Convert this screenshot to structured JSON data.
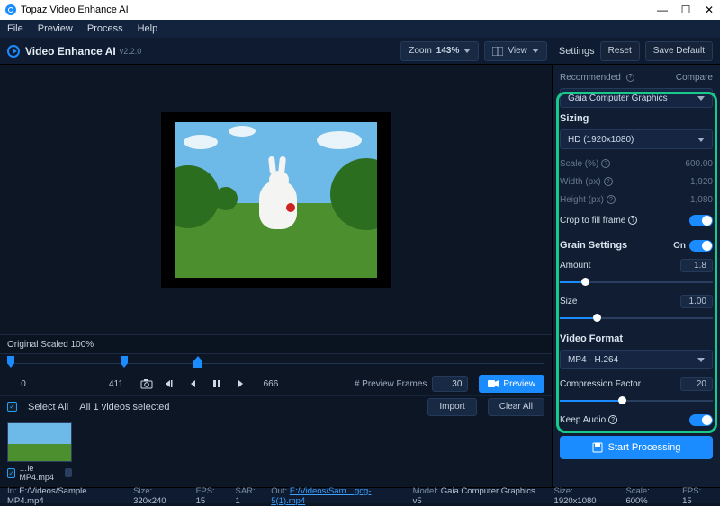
{
  "window": {
    "title": "Topaz Video Enhance AI",
    "controls": {
      "min": "—",
      "max": "☐",
      "close": "✕"
    }
  },
  "menus": [
    "File",
    "Preview",
    "Process",
    "Help"
  ],
  "header": {
    "app_name": "Video Enhance AI",
    "version": "v2.2.0",
    "zoom_label": "Zoom",
    "zoom_value": "143%",
    "view_label": "View",
    "settings_label": "Settings",
    "reset_label": "Reset",
    "save_default_label": "Save Default"
  },
  "preview": {
    "scale_label": "Original Scaled 100%"
  },
  "timeline": {
    "start": "0",
    "current": "411",
    "end": "666",
    "preview_frames_label": "# Preview Frames",
    "preview_frames_value": "30",
    "preview_button": "Preview"
  },
  "list": {
    "select_all": "Select All",
    "selected_text": "All 1 videos selected",
    "import_btn": "Import",
    "clear_btn": "Clear All",
    "thumb_name": "…le MP4.mp4"
  },
  "panel": {
    "recommended": "Recommended",
    "compare": "Compare",
    "model_dd": "Gaia Computer Graphics",
    "sizing_title": "Sizing",
    "size_preset": "HD (1920x1080)",
    "scale_label": "Scale (%)",
    "scale_val": "600.00",
    "width_label": "Width (px)",
    "width_val": "1,920",
    "height_label": "Height (px)",
    "height_val": "1,080",
    "crop_label": "Crop to fill frame",
    "grain_title": "Grain Settings",
    "grain_on": "On",
    "grain_amount_label": "Amount",
    "grain_amount_val": "1.8",
    "grain_size_label": "Size",
    "grain_size_val": "1.00",
    "vformat_title": "Video Format",
    "vformat_dd": "MP4 · H.264",
    "compression_label": "Compression Factor",
    "compression_val": "20",
    "keep_audio_label": "Keep Audio",
    "start_btn": "Start Processing"
  },
  "status": {
    "in_label": "In:",
    "in_path": "E:/Videos/Sample MP4.mp4",
    "size_label": "Size:",
    "size_val": "320x240",
    "fps_label": "FPS:",
    "fps_val": "15",
    "sar_label": "SAR:",
    "sar_val": "1",
    "out_label": "Out:",
    "out_path": "E:/Videos/Sam…gcg-5(1).mp4",
    "model_label": "Model:",
    "model_val": "Gaia Computer Graphics v5",
    "size2_label": "Size:",
    "size2_val": "1920x1080",
    "scale2_label": "Scale:",
    "scale2_val": "600%",
    "fps2_label": "FPS:",
    "fps2_val": "15"
  }
}
